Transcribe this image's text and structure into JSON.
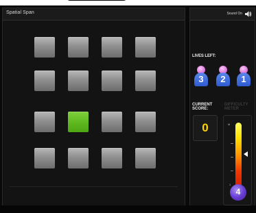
{
  "header": {
    "title": "Spatial Span",
    "sound_label": "Sound On",
    "sound_icon": "speaker-icon"
  },
  "board": {
    "rows": 4,
    "cols": 4,
    "lit_tiles": [
      {
        "row": 2,
        "col": 1
      }
    ],
    "tile_color": "#9a9a9a",
    "lit_color": "#5cb61c"
  },
  "lives": {
    "label": "LIVES LEFT:",
    "items": [
      "3",
      "2",
      "1"
    ]
  },
  "score": {
    "label": "CURRENT SCORE:",
    "value": "0"
  },
  "difficulty": {
    "label": "DIFFICULTY METER",
    "max_label": "M",
    "min_label": "1",
    "level": "4",
    "pointer_level": 0.55
  }
}
